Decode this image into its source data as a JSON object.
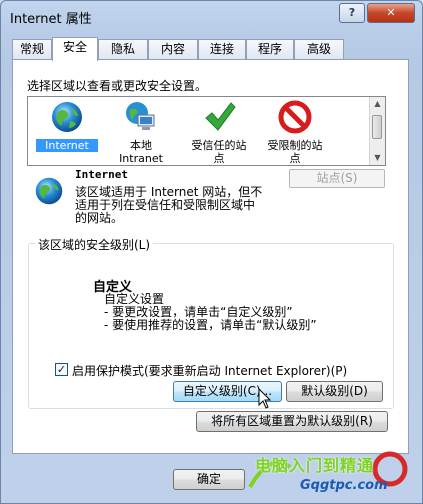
{
  "window": {
    "title": "Internet 属性",
    "help_label": "?",
    "close_label": "✕"
  },
  "tabs": [
    {
      "label": "常规"
    },
    {
      "label": "安全"
    },
    {
      "label": "隐私"
    },
    {
      "label": "内容"
    },
    {
      "label": "连接"
    },
    {
      "label": "程序"
    },
    {
      "label": "高级"
    }
  ],
  "security": {
    "instruction": "选择区域以查看或更改安全设置。",
    "zones": [
      {
        "label": "Internet",
        "icon": "globe-icon"
      },
      {
        "label": "本地\nIntranet",
        "icon": "intranet-icon"
      },
      {
        "label": "受信任的站\n点",
        "icon": "checkmark-icon"
      },
      {
        "label": "受限制的站\n点",
        "icon": "restricted-icon"
      }
    ],
    "selected_zone": "Internet",
    "zone_title": "Internet",
    "zone_description": "该区域适用于 Internet 网站，但不适用于列在受信任和受限制区域中的网站。",
    "sites_button": "站点(S)",
    "level_group_label": "该区域的安全级别(L)",
    "level_title": "自定义",
    "level_lines": [
      "自定义设置",
      "- 要更改设置，请单击“自定义级别”",
      "- 要使用推荐的设置，请单击“默认级别”"
    ],
    "protected_mode_label": "启用保护模式(要求重新启动 Internet Explorer)(P)",
    "protected_mode_checked": true,
    "custom_level_button": "自定义级别(C)...",
    "default_level_button": "默认级别(D)",
    "reset_all_button": "将所有区域重置为默认级别(R)"
  },
  "footer": {
    "ok_button": "确定"
  },
  "watermark": {
    "text": "电脑入门到精通",
    "url": "Gqgtpc.com"
  }
}
